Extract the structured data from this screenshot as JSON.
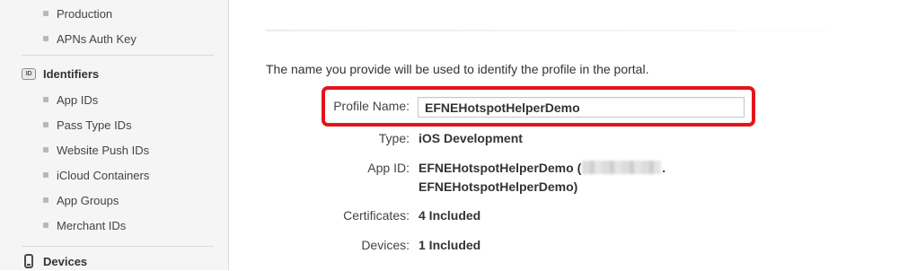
{
  "sidebar": {
    "certificates_items": [
      {
        "label": "Production"
      },
      {
        "label": "APNs Auth Key"
      }
    ],
    "identifiers": {
      "icon_text": "ID",
      "label": "Identifiers",
      "items": [
        {
          "label": "App IDs"
        },
        {
          "label": "Pass Type IDs"
        },
        {
          "label": "Website Push IDs"
        },
        {
          "label": "iCloud Containers"
        },
        {
          "label": "App Groups"
        },
        {
          "label": "Merchant IDs"
        }
      ]
    },
    "devices": {
      "label": "Devices"
    }
  },
  "main": {
    "intro_text": "The name you provide will be used to identify the profile in the portal.",
    "profile_name": {
      "label": "Profile Name:",
      "value": "EFNEHotspotHelperDemo"
    },
    "type": {
      "label": "Type:",
      "value": "iOS Development"
    },
    "app_id": {
      "label": "App ID:",
      "value_part1": "EFNEHotspotHelperDemo (",
      "value_part1_suffix": ".",
      "value_line2": "EFNEHotspotHelperDemo)"
    },
    "certificates": {
      "label": "Certificates:",
      "value": "4 Included"
    },
    "devices": {
      "label": "Devices:",
      "value": "1 Included"
    }
  },
  "colors": {
    "highlight": "#e3151a",
    "sidebar_bg": "#f5f5f5"
  }
}
